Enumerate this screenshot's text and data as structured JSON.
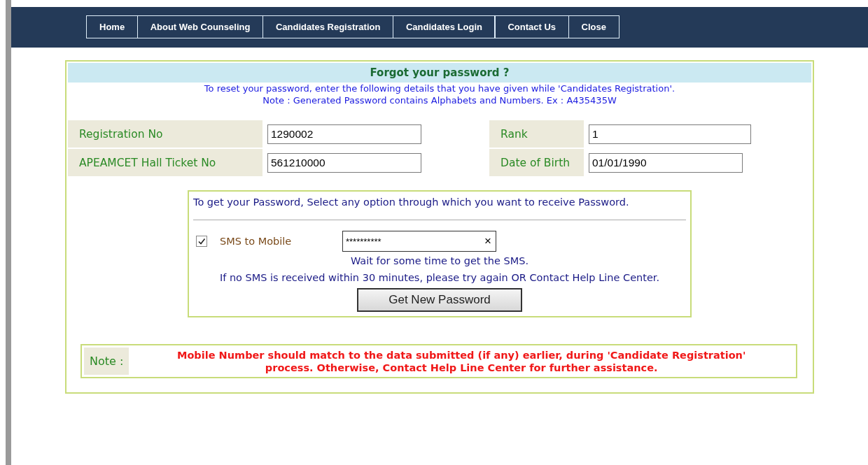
{
  "nav": [
    {
      "label": "Home"
    },
    {
      "label": "About Web Counseling"
    },
    {
      "label": "Candidates Registration"
    },
    {
      "label": "Candidates Login"
    },
    {
      "label": "Contact Us"
    },
    {
      "label": "Close"
    }
  ],
  "form": {
    "title": "Forgot your password ?",
    "intro": [
      "To reset your password, enter the following details that you have given while 'Candidates Registration'.",
      "Note : Generated Password contains Alphabets and Numbers. Ex : A435435W"
    ],
    "fields": [
      [
        {
          "label": "Registration No",
          "value": "1290002"
        },
        {
          "label": "Rank",
          "value": "1"
        }
      ],
      [
        {
          "label": "APEAMCET Hall Ticket No",
          "value": "561210000"
        },
        {
          "label": "Date of Birth",
          "value": "01/01/1990"
        }
      ]
    ],
    "options": {
      "heading": "To get your Password, Select any option through which you want to receive Password.",
      "sms_label": "SMS to Mobile",
      "checked": true,
      "mobile_value": "**********",
      "clear": "×",
      "messages": [
        "Wait for some time to get the SMS.",
        "If no SMS is received within 30 minutes, please try again OR Contact Help Line Center."
      ],
      "button": "Get New Password"
    },
    "note": {
      "label": "Note :",
      "text": [
        "Mobile Number should match to the data submitted (if any) earlier, during 'Candidate Registration'",
        "process. Otherwise, Contact Help Line Center for further assistance."
      ]
    }
  }
}
